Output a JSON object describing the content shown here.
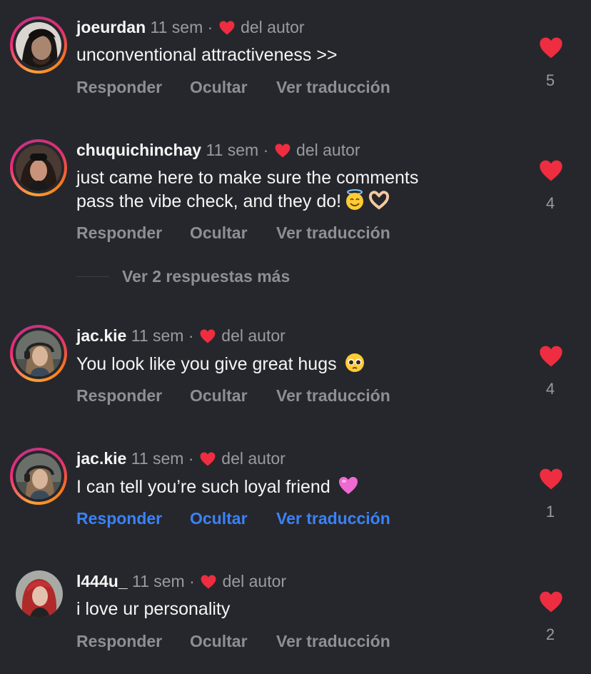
{
  "colors": {
    "background": "#26272c",
    "heart": "#ef2d41",
    "muted": "#9a9aa0",
    "link_blue": "#3a82f6"
  },
  "comments": [
    {
      "username": "joeurdan",
      "time": "11 sem",
      "dot": "·",
      "liked_by_author": "del autor",
      "text": "unconventional attractiveness >>",
      "emoji": [],
      "actions": {
        "reply": "Responder",
        "hide": "Ocultar",
        "translate": "Ver traducción"
      },
      "likes": "5",
      "avatar_ring": true
    },
    {
      "username": "chuquichinchay",
      "time": "11 sem",
      "dot": "·",
      "liked_by_author": "del autor",
      "text_line1": "just came here to make sure the comments",
      "text_line2": "pass the vibe check, and they do!",
      "emoji": [
        "smiling-face-with-halo-icon",
        "heart-hands-icon"
      ],
      "actions": {
        "reply": "Responder",
        "hide": "Ocultar",
        "translate": "Ver traducción"
      },
      "likes": "4",
      "avatar_ring": true,
      "more_replies": "Ver 2 respuestas más"
    },
    {
      "username": "jac.kie",
      "time": "11 sem",
      "dot": "·",
      "liked_by_author": "del autor",
      "text": "You look like you give great hugs",
      "emoji": [
        "pleading-face-icon"
      ],
      "actions": {
        "reply": "Responder",
        "hide": "Ocultar",
        "translate": "Ver traducción"
      },
      "likes": "4",
      "avatar_ring": true
    },
    {
      "username": "jac.kie",
      "time": "11 sem",
      "dot": "·",
      "liked_by_author": "del autor",
      "text": "I can tell you’re such loyal friend",
      "emoji": [
        "pink-heart-icon"
      ],
      "actions": {
        "reply": "Responder",
        "hide": "Ocultar",
        "translate": "Ver traducción"
      },
      "actions_highlighted": true,
      "likes": "1",
      "avatar_ring": true
    },
    {
      "username": "l444u_",
      "time": "11 sem",
      "dot": "·",
      "liked_by_author": "del autor",
      "text": "i love ur personality",
      "emoji": [],
      "actions": {
        "reply": "Responder",
        "hide": "Ocultar",
        "translate": "Ver traducción"
      },
      "likes": "2",
      "avatar_ring": false
    }
  ]
}
